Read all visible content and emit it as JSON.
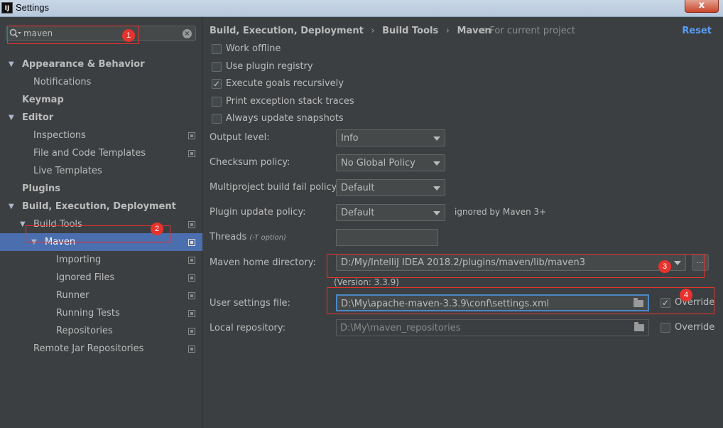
{
  "window": {
    "title": "Settings",
    "logo": "IJ",
    "close_label": "x"
  },
  "search": {
    "value": "maven",
    "clear_label": "×"
  },
  "tree": [
    {
      "label": "Appearance & Behavior",
      "level": 0,
      "arrow": "▼",
      "bold": true,
      "proj": false
    },
    {
      "label": "Notifications",
      "level": 1,
      "arrow": "",
      "bold": false,
      "proj": false
    },
    {
      "label": "Keymap",
      "level": 0,
      "arrow": "",
      "bold": true,
      "proj": false
    },
    {
      "label": "Editor",
      "level": 0,
      "arrow": "▼",
      "bold": true,
      "proj": false
    },
    {
      "label": "Inspections",
      "level": 1,
      "arrow": "",
      "bold": false,
      "proj": true
    },
    {
      "label": "File and Code Templates",
      "level": 1,
      "arrow": "",
      "bold": false,
      "proj": true
    },
    {
      "label": "Live Templates",
      "level": 1,
      "arrow": "",
      "bold": false,
      "proj": false
    },
    {
      "label": "Plugins",
      "level": 0,
      "arrow": "",
      "bold": true,
      "proj": false
    },
    {
      "label": "Build, Execution, Deployment",
      "level": 0,
      "arrow": "▼",
      "bold": true,
      "proj": false
    },
    {
      "label": "Build Tools",
      "level": 1,
      "arrow": "▼",
      "bold": false,
      "proj": true
    },
    {
      "label": "Maven",
      "level": 2,
      "arrow": "▼",
      "bold": false,
      "proj": true,
      "selected": true
    },
    {
      "label": "Importing",
      "level": 3,
      "arrow": "",
      "bold": false,
      "proj": true
    },
    {
      "label": "Ignored Files",
      "level": 3,
      "arrow": "",
      "bold": false,
      "proj": true
    },
    {
      "label": "Runner",
      "level": 3,
      "arrow": "",
      "bold": false,
      "proj": true
    },
    {
      "label": "Running Tests",
      "level": 3,
      "arrow": "",
      "bold": false,
      "proj": true
    },
    {
      "label": "Repositories",
      "level": 3,
      "arrow": "",
      "bold": false,
      "proj": true
    },
    {
      "label": "Remote Jar Repositories",
      "level": 1,
      "arrow": "",
      "bold": false,
      "proj": true
    }
  ],
  "breadcrumb": {
    "part1": "Build, Execution, Deployment",
    "sep1": "›",
    "part2": "Build Tools",
    "sep2": "›",
    "part3": "Maven"
  },
  "scope": "⧉ For current project",
  "reset": "Reset",
  "checkboxes": [
    {
      "label": "Work offline",
      "checked": false
    },
    {
      "label": "Use plugin registry",
      "checked": false
    },
    {
      "label": "Execute goals recursively",
      "checked": true
    },
    {
      "label": "Print exception stack traces",
      "checked": false
    },
    {
      "label": "Always update snapshots",
      "checked": false
    }
  ],
  "form": {
    "output_level": {
      "label": "Output level:",
      "value": "Info"
    },
    "checksum": {
      "label": "Checksum policy:",
      "value": "No Global Policy"
    },
    "multiproject": {
      "label": "Multiproject build fail policy:",
      "value": "Default"
    },
    "plugin_update": {
      "label": "Plugin update policy:",
      "value": "Default",
      "note": "ignored by Maven 3+"
    },
    "threads": {
      "label": "Threads",
      "hint": "(-T option)",
      "value": ""
    },
    "maven_home": {
      "label": "Maven home directory:",
      "value": "D:/My/IntelliJ IDEA 2018.2/plugins/maven/lib/maven3",
      "browse": "...",
      "version": "(Version: 3.3.9)"
    },
    "user_settings": {
      "label": "User settings file:",
      "value": "D:\\My\\apache-maven-3.3.9\\conf\\settings.xml",
      "override_label": "Override",
      "override_checked": true
    },
    "local_repo": {
      "label": "Local repository:",
      "value": "D:\\My\\maven_repositories",
      "override_label": "Override",
      "override_checked": false
    }
  },
  "annotations": {
    "b1": "1",
    "b2": "2",
    "b3": "3",
    "b4": "4"
  },
  "colors": {
    "selection": "#4b6eaf",
    "annotation": "#e8322d",
    "link": "#589df6"
  }
}
